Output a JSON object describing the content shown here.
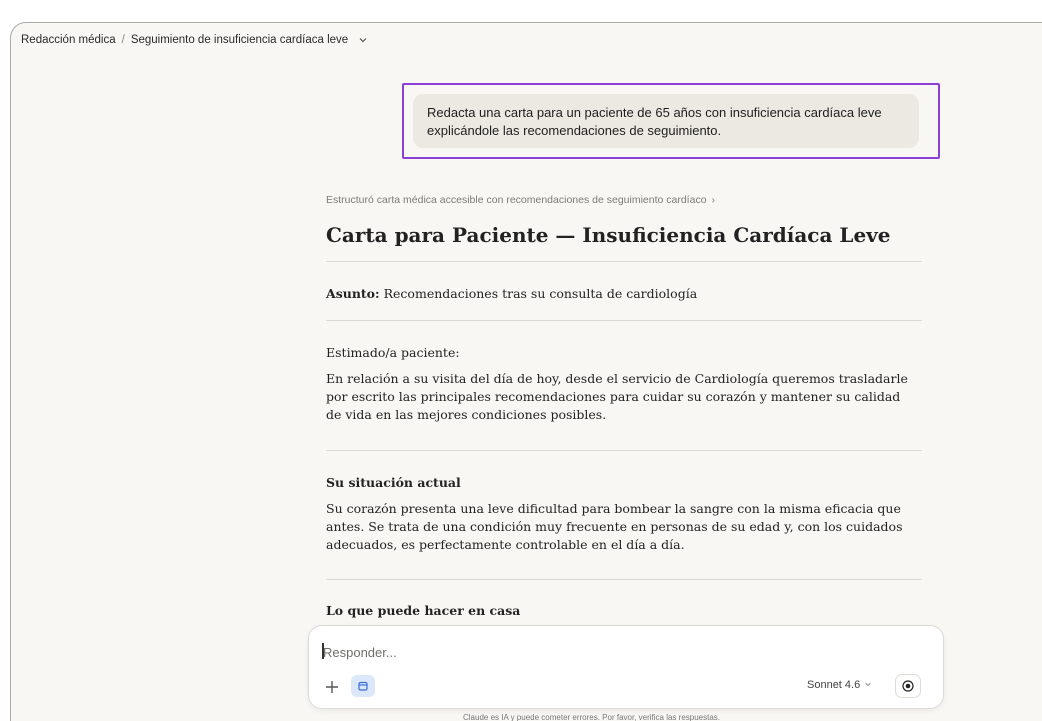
{
  "breadcrumb": {
    "project": "Redacción médica",
    "separator": "/",
    "conversation": "Seguimiento de insuficiencia cardíaca leve"
  },
  "user_message": "Redacta una carta para un paciente de 65 años con insuficiencia cardíaca leve explicándole las recomendaciones de seguimiento.",
  "thinking_summary": "Estructuró carta médica accesible con recomendaciones de seguimiento cardíaco",
  "thinking_arrow": "›",
  "document": {
    "title": "Carta para Paciente — Insuficiencia Cardíaca Leve",
    "subject_label": "Asunto:",
    "subject_text": "Recomendaciones tras su consulta de cardiología",
    "greeting": "Estimado/a paciente:",
    "intro": "En relación a su visita del día de hoy, desde el servicio de Cardiología queremos trasladarle por escrito las principales recomendaciones para cuidar su corazón y mantener su calidad de vida en las mejores condiciones posibles.",
    "section1_heading": "Su situación actual",
    "section1_body": "Su corazón presenta una leve dificultad para bombear la sangre con la misma eficacia que antes. Se trata de una condición muy frecuente en personas de su edad y, con los cuidados adecuados, es perfectamente controlable en el día a día.",
    "section2_heading": "Lo que puede hacer en casa"
  },
  "composer": {
    "placeholder": "Responder...",
    "model": "Sonnet 4.6",
    "tool_button_color": "#dbe7fb"
  },
  "disclaimer": "Claude es IA y puede cometer errores. Por favor, verifica las respuestas.",
  "colors": {
    "highlight_frame": "#8e3fd6",
    "user_bubble": "#ebe9e2",
    "background": "#f8f7f3"
  }
}
